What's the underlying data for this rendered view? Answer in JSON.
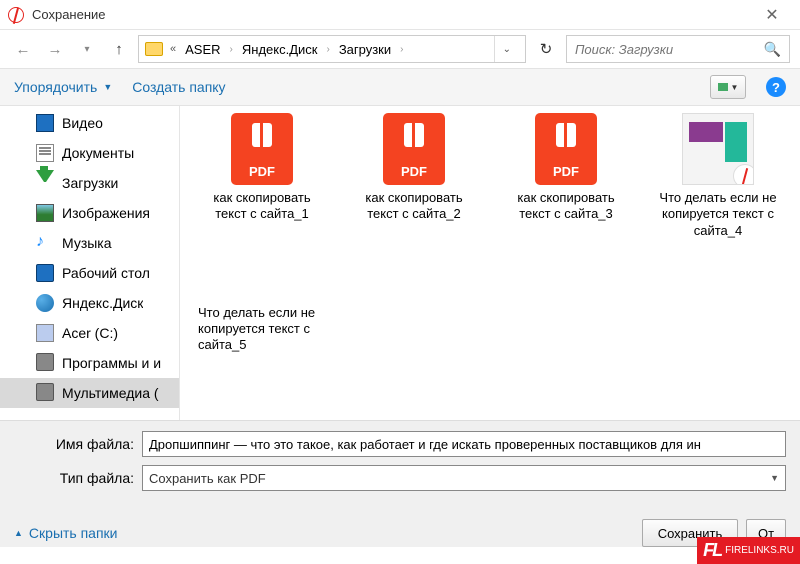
{
  "window": {
    "title": "Сохранение"
  },
  "breadcrumb": {
    "root": "ASER",
    "mid": "Яндекс.Диск",
    "leaf": "Загрузки"
  },
  "search": {
    "placeholder": "Поиск: Загрузки"
  },
  "toolbar": {
    "organize": "Упорядочить",
    "newfolder": "Создать папку"
  },
  "sidebar": {
    "items": [
      {
        "label": "Видео",
        "icon": "video"
      },
      {
        "label": "Документы",
        "icon": "doc"
      },
      {
        "label": "Загрузки",
        "icon": "down"
      },
      {
        "label": "Изображения",
        "icon": "img"
      },
      {
        "label": "Музыка",
        "icon": "music"
      },
      {
        "label": "Рабочий стол",
        "icon": "desk"
      },
      {
        "label": "Яндекс.Диск",
        "icon": "yadisk"
      },
      {
        "label": "Acer (C:)",
        "icon": "acer"
      },
      {
        "label": "Программы и и",
        "icon": "drive2"
      },
      {
        "label": "Мультимедиа (",
        "icon": "drive2",
        "sel": true
      }
    ]
  },
  "files": [
    {
      "name": "как скопировать текст с сайта_1",
      "type": "pdf"
    },
    {
      "name": "как скопировать текст с сайта_2",
      "type": "pdf"
    },
    {
      "name": "как скопировать текст с сайта_3",
      "type": "pdf"
    },
    {
      "name": "Что делать если не копируется текст с сайта_4",
      "type": "doc"
    },
    {
      "name": "Что делать если не копируется текст с сайта_5",
      "type": "text"
    }
  ],
  "pdf_ext": "PDF",
  "form": {
    "name_label": "Имя файла:",
    "name_value": "Дропшиппинг — что это такое, как работает и где искать проверенных поставщиков для ин",
    "type_label": "Тип файла:",
    "type_value": "Сохранить как PDF"
  },
  "actions": {
    "hide": "Скрыть папки",
    "save": "Сохранить",
    "cancel": "От"
  },
  "watermark": {
    "logo": "FL",
    "text": "FIRELINKS.RU"
  }
}
